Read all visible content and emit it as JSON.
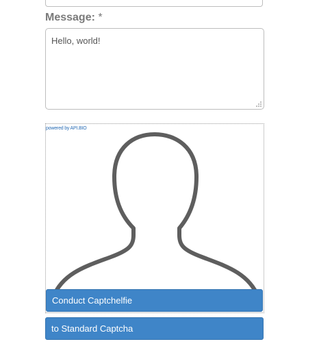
{
  "form": {
    "message_label": "Message:",
    "required_marker": "*",
    "message_value": "Hello, world!"
  },
  "captcha": {
    "powered_by": "powered by API.BIO",
    "conduct_button": "Conduct Captchelfie",
    "standard_button": "to Standard Captcha",
    "button_color": "#3f85c8",
    "silhouette_icon": "user-silhouette-icon"
  }
}
